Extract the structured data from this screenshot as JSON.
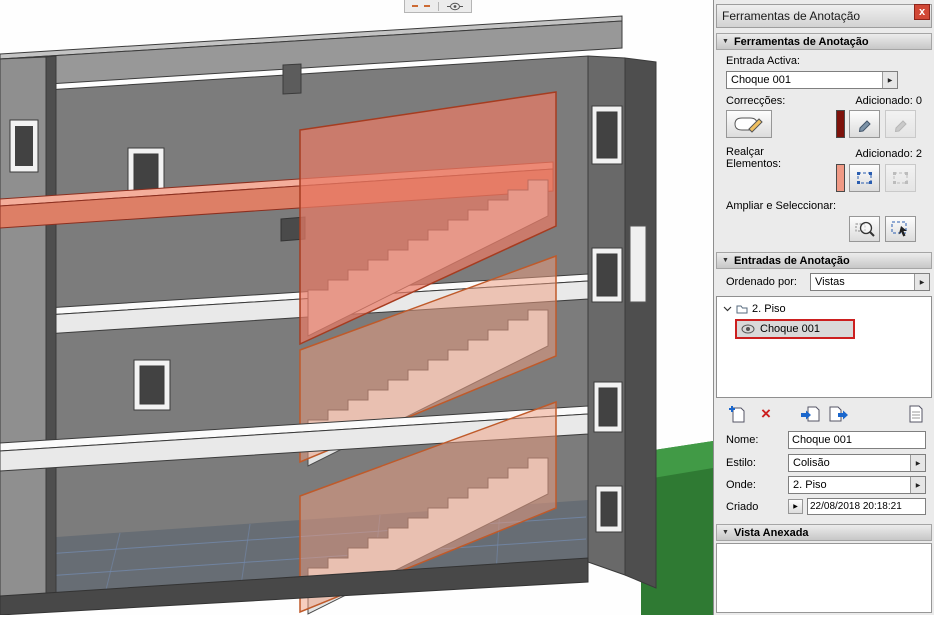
{
  "panel": {
    "title": "Ferramentas de Anotação",
    "close_glyph": "x",
    "tools": {
      "header": "Ferramentas de Anotação",
      "active_entry_label": "Entrada Activa:",
      "active_entry_value": "Choque 001",
      "corrections_label": "Correcções:",
      "corrections_added_label": "Adicionado: 0",
      "highlight_label_1": "Realçar",
      "highlight_label_2": "Elementos:",
      "highlight_added_label": "Adicionado: 2",
      "zoom_select_label": "Ampliar e Seleccionar:"
    },
    "entries": {
      "header": "Entradas de Anotação",
      "sorted_by_label": "Ordenado por:",
      "sorted_by_value": "Vistas",
      "tree_parent": "2. Piso",
      "tree_child": "Choque 001",
      "name_label": "Nome:",
      "name_value": "Choque 001",
      "style_label": "Estilo:",
      "style_value": "Colisão",
      "where_label": "Onde:",
      "where_value": "2. Piso",
      "created_label": "Criado",
      "created_value": "22/08/2018 20:18:21"
    },
    "attached": {
      "header": "Vista Anexada"
    }
  },
  "glyphs": {
    "section_collapse": "▼",
    "combo_arrow": "▶",
    "delete_x": "×"
  },
  "colors": {
    "selection_red": "#cc1f1f",
    "highlight_salmon": "#f09a86",
    "correction_darkred": "#7d120b",
    "grass_green": "#2f7a33"
  }
}
